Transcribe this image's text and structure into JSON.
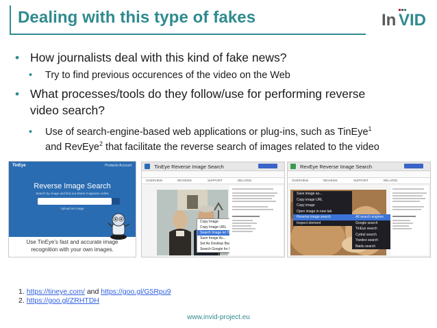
{
  "slide": {
    "title": "Dealing with this type of fakes",
    "logo_text": {
      "in": "In",
      "vid": "VID"
    },
    "accent_color": "#2f8a8e",
    "bullets": [
      {
        "level": 1,
        "text": "How journalists deal with this kind of fake news?"
      },
      {
        "level": 2,
        "text": "Try to find previous occurences of the video on the Web"
      },
      {
        "level": 1,
        "line1": "What processes/tools do they follow/use for performing reverse",
        "line2": "video search?"
      },
      {
        "level": 2,
        "line1_pre": "Use of search-engine-based web applications or plug-ins, such as TinEye",
        "sup1": "1",
        "line2_pre": "and RevEye",
        "sup2": "2",
        "line2_post": " that facilitate the reverse search of images related to the video"
      }
    ],
    "screenshots": {
      "tineye_home": {
        "brand": "TinEye",
        "menu": "Products   Account",
        "heading": "Reverse Image Search",
        "subtitle": "Search by image and find out where it appears online",
        "below_search": "Upload an image",
        "tagline_line1": "Use TinEye's fast and accurate image",
        "tagline_line2": "recognition with your own images."
      },
      "tineye_ext": {
        "title": "TinEye Reverse Image Search",
        "tabs": [
          "OVERVIEW",
          "REVIEWS",
          "SUPPORT",
          "RELATED"
        ],
        "menu": [
          "Copy Image",
          "Copy Image URL",
          "Search Image on TinEye",
          "Save Image As...",
          "Set As Desktop Background...",
          "Search Google for Image"
        ]
      },
      "reveye_ext": {
        "title": "RevEye Reverse Image Search",
        "tabs": [
          "OVERVIEW",
          "REVIEWS",
          "SUPPORT",
          "RELATED"
        ],
        "menu": [
          "Save image as...",
          "Copy image URL",
          "Copy image",
          "Open image in new tab",
          "Reverse image search",
          "Inspect element"
        ],
        "submenu": [
          "All search engines",
          "Google search",
          "TinEye search",
          "Cydral search",
          "Yandex search",
          "Baidu search"
        ]
      }
    },
    "footnotes": [
      {
        "num": "1.",
        "link1": "https://tineye.com/",
        "mid": "and",
        "link2": "https://goo.gl/G5Rpu9"
      },
      {
        "num": "2.",
        "link1": "https://goo.gl/ZRHTDH"
      }
    ],
    "footer": "www.invid-project.eu"
  }
}
